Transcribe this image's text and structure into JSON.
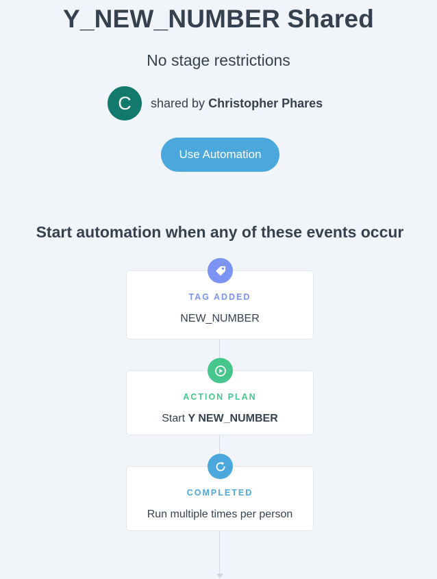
{
  "header": {
    "title": "Y_NEW_NUMBER Shared",
    "subtitle": "No stage restrictions"
  },
  "shared": {
    "avatar_initial": "C",
    "prefix": "shared by",
    "name": "Christopher Phares",
    "avatar_color": "#117a6c"
  },
  "actions": {
    "use_automation_label": "Use Automation",
    "button_color": "#4aa8dc"
  },
  "section": {
    "heading": "Start automation when any of these events occur"
  },
  "events": [
    {
      "icon": "tag-icon",
      "label": "TAG ADDED",
      "label_color": "#7b93f2",
      "badge_color": "#7b93f2",
      "value": "NEW_NUMBER"
    },
    {
      "icon": "play-icon",
      "label": "ACTION PLAN",
      "label_color": "#45c68c",
      "badge_color": "#45c68c",
      "value_prefix": "Start",
      "value_strong": "Y NEW_NUMBER"
    },
    {
      "icon": "refresh-icon",
      "label": "COMPLETED",
      "label_color": "#4aa8dc",
      "badge_color": "#4aa8dc",
      "value": "Run multiple times per person"
    }
  ]
}
